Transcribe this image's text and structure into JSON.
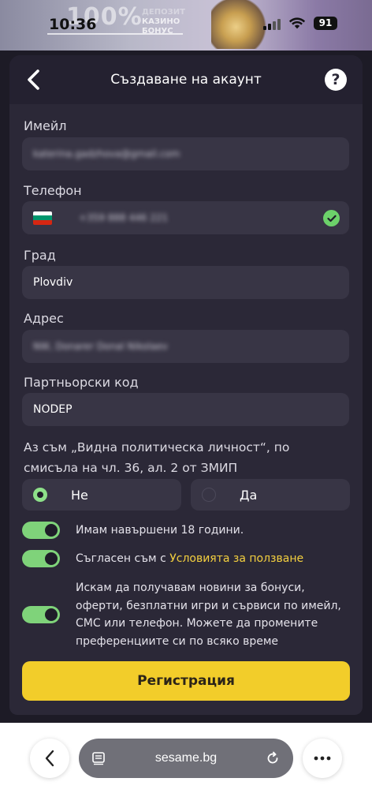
{
  "status_bar": {
    "time": "10:36",
    "battery": "91",
    "promo_percent": "100%",
    "promo_text_line1": "КАЗИНО",
    "promo_text_line2": "БОНУС",
    "promo_text_top": "ДЕПОЗИТ"
  },
  "header": {
    "title": "Създаване на акаунт",
    "help": "?"
  },
  "form": {
    "email": {
      "label": "Имейл",
      "value": "katerina.gadzhova@gmail.com"
    },
    "phone": {
      "label": "Телефон",
      "value": "+359 888 446 221",
      "flag_colors": [
        "#ffffff",
        "#00966e",
        "#d62612"
      ]
    },
    "city": {
      "label": "Град",
      "value": "Plovdiv"
    },
    "address": {
      "label": "Адрес",
      "value": "NW, Donarer Donal Nikolaev"
    },
    "partner_code": {
      "label": "Партньорски код",
      "value": "NODEP"
    },
    "pep_question": "Аз съм „Видна политическа личност“, по смисъла на чл. 36, ал. 2 от ЗМИП",
    "pep_options": [
      {
        "label": "Не",
        "selected": true
      },
      {
        "label": "Да",
        "selected": false
      }
    ],
    "toggles": {
      "age": {
        "text": "Имам навършени 18 години.",
        "on": true
      },
      "terms": {
        "prefix": "Съгласен съм с ",
        "link": "Условията за ползване",
        "on": true
      },
      "news": {
        "lines": [
          "Искам да получавам новини за бонуси,",
          "оферти, безплатни игри и сървиси по имейл,",
          "СМС или телефон. Можете да промените",
          "преференциите си по всяко време"
        ],
        "on": true
      }
    },
    "submit": "Регистрация"
  },
  "browser": {
    "url": "sesame.bg"
  },
  "colors": {
    "accent": "#f2cd2a",
    "toggle_on": "#7fd37a",
    "card_bg": "#2b2837",
    "field_bg": "#383545",
    "link": "#f4d03f"
  }
}
